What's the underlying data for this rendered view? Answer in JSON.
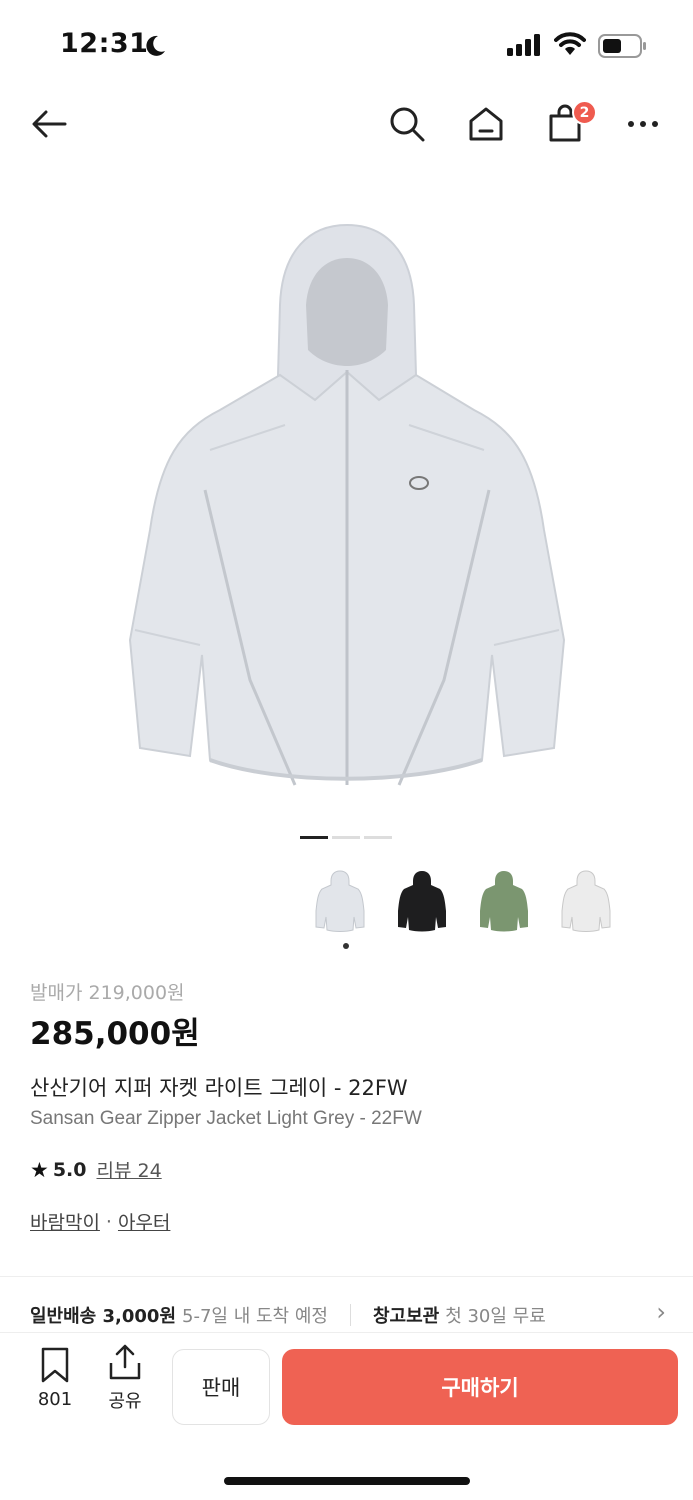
{
  "status": {
    "time": "12:31"
  },
  "nav": {
    "cart_count": "2"
  },
  "gallery": {
    "pages": 3,
    "active_page": 1,
    "thumbnails": [
      "light-grey",
      "black",
      "green",
      "white"
    ]
  },
  "product": {
    "release_price": "발매가 219,000원",
    "price": "285,000원",
    "name_ko": "산산기어 지퍼 자켓 라이트 그레이 - 22FW",
    "name_en": "Sansan Gear Zipper Jacket Light Grey - 22FW",
    "rating": "5.0",
    "review_label": "리뷰 24",
    "category_1": "바람막이",
    "category_sep": "·",
    "category_2": "아우터"
  },
  "delivery": {
    "standard_label": "일반배송 3,000원",
    "standard_eta": "5-7일 내 도착 예정",
    "storage_label": "창고보관",
    "storage_note": "첫 30일 무료",
    "chevron": "›"
  },
  "actions": {
    "bookmark_count": "801",
    "share_label": "공유",
    "sell_label": "판매",
    "buy_label": "구매하기"
  },
  "colors": {
    "accent": "#ef6253",
    "badge": "#ef5b4f"
  }
}
